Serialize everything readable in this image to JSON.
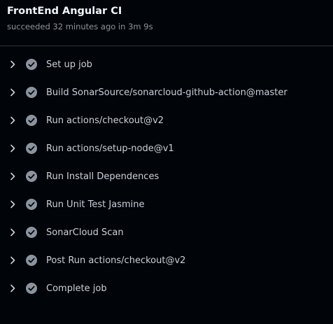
{
  "header": {
    "title": "FrontEnd Angular CI",
    "status": "succeeded 32 minutes ago in 3m 9s"
  },
  "colors": {
    "background": "#010409",
    "check": "#8b949e",
    "divider": "#30363d"
  },
  "icons": {
    "expand": "chevron-right-icon",
    "status": "check-circle-icon"
  },
  "steps": [
    {
      "label": "Set up job"
    },
    {
      "label": "Build SonarSource/sonarcloud-github-action@master"
    },
    {
      "label": "Run actions/checkout@v2"
    },
    {
      "label": "Run actions/setup-node@v1"
    },
    {
      "label": "Run Install Dependences"
    },
    {
      "label": "Run Unit Test Jasmine"
    },
    {
      "label": "SonarCloud Scan"
    },
    {
      "label": "Post Run actions/checkout@v2"
    },
    {
      "label": "Complete job"
    }
  ]
}
